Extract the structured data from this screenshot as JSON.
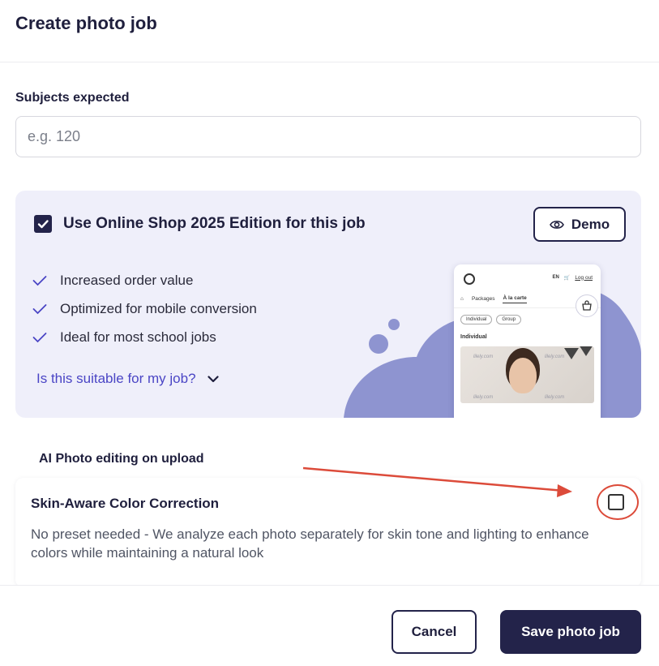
{
  "header": {
    "title": "Create photo job"
  },
  "subjects": {
    "label": "Subjects expected",
    "placeholder": "e.g. 120",
    "value": ""
  },
  "online_shop": {
    "checked": true,
    "title": "Use Online Shop 2025 Edition for this job",
    "demo_label": "Demo",
    "benefits": [
      "Increased order value",
      "Optimized for mobile conversion",
      "Ideal for most school jobs"
    ],
    "suitability_link": "Is this suitable for my job?",
    "preview": {
      "lang": "EN",
      "logout": "Log out",
      "tabs": [
        "Packages",
        "À la carte"
      ],
      "chips": [
        "Individual",
        "Group"
      ],
      "section": "Individual",
      "watermark": "lilely.com"
    }
  },
  "ai_editing": {
    "section_label": "AI Photo editing on upload",
    "option_title": "Skin-Aware Color Correction",
    "option_description": "No preset needed - We analyze each photo separately for skin tone and lighting to enhance colors while maintaining a natural look",
    "checked": false
  },
  "footer": {
    "cancel_label": "Cancel",
    "save_label": "Save photo job"
  },
  "colors": {
    "primary": "#23234a",
    "link": "#4a45c5",
    "card_bg": "#efeffa",
    "blob": "#8e94d0",
    "annotation": "#dc4b3a"
  }
}
